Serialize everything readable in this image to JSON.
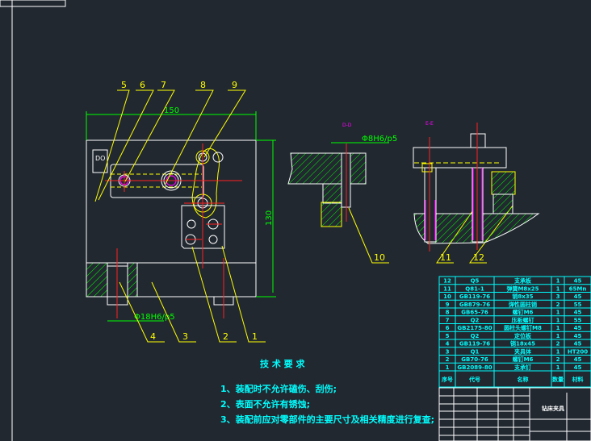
{
  "drawing": {
    "dimensions": {
      "width": "150",
      "height": "130",
      "fit_main": "Φ18H6/p5",
      "fit_section": "Φ8H6/p5"
    },
    "balloons_top": [
      "5",
      "6",
      "7",
      "8",
      "9"
    ],
    "balloons_bottom": [
      "4",
      "3",
      "2",
      "1"
    ],
    "balloons_section": [
      "10",
      "11",
      "12"
    ],
    "section_marks": [
      "D-D",
      "E-E"
    ],
    "colors": {
      "outline": "#ffffff",
      "leader": "#ffff00",
      "centerline": "#ff2020",
      "dimension": "#00ff00",
      "hatch": "#00ff00",
      "table": "#00ffff",
      "highlight": "#ff00ff"
    }
  },
  "requirements": {
    "title": "技 术 要 求",
    "items": [
      "1、装配时不允许磕伤、刮伤;",
      "2、表面不允许有锈蚀;",
      "3、装配前应对零部件的主要尺寸及相关精度进行复查;"
    ]
  },
  "bom": {
    "header": {
      "no": "序号",
      "code": "代号",
      "name": "名称",
      "qty": "数量",
      "material": "材料"
    },
    "rows": [
      {
        "no": "12",
        "code": "Q5",
        "name": "支承板",
        "qty": "1",
        "material": "45"
      },
      {
        "no": "11",
        "code": "Q81-1",
        "name": "弹簧M8x25",
        "qty": "1",
        "material": "65Mn"
      },
      {
        "no": "10",
        "code": "GB119-76",
        "name": "销8x35",
        "qty": "3",
        "material": "45"
      },
      {
        "no": "9",
        "code": "GB879-76",
        "name": "弹性圆柱销",
        "qty": "2",
        "material": "55"
      },
      {
        "no": "8",
        "code": "GB65-76",
        "name": "螺钉M6",
        "qty": "1",
        "material": "45"
      },
      {
        "no": "7",
        "code": "Q2",
        "name": "压板螺钉",
        "qty": "1",
        "material": "55"
      },
      {
        "no": "6",
        "code": "GB2175-80",
        "name": "圆柱头螺钉M8",
        "qty": "1",
        "material": "45"
      },
      {
        "no": "5",
        "code": "Q2",
        "name": "定位板",
        "qty": "1",
        "material": "45"
      },
      {
        "no": "4",
        "code": "GB119-76",
        "name": "销18x45",
        "qty": "2",
        "material": "45"
      },
      {
        "no": "3",
        "code": "Q1",
        "name": "夹具体",
        "qty": "1",
        "material": "HT200"
      },
      {
        "no": "2",
        "code": "GB70-76",
        "name": "螺钉M6",
        "qty": "2",
        "material": "45"
      },
      {
        "no": "1",
        "code": "GB2089-80",
        "name": "支承钉",
        "qty": "1",
        "material": "45"
      }
    ]
  },
  "title_block": {
    "name": "钻床夹具"
  }
}
